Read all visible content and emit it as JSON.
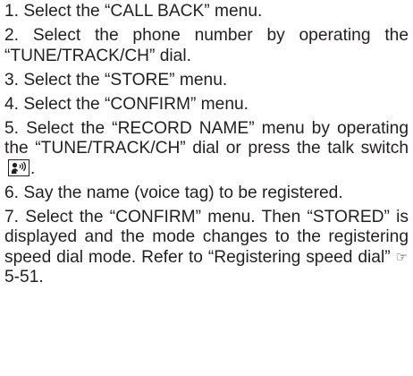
{
  "steps": [
    {
      "number": "1.",
      "text": "Select the “CALL BACK” menu."
    },
    {
      "number": "2.",
      "text": "Select the phone number by operating the “TUNE/TRACK/CH” dial."
    },
    {
      "number": "3.",
      "text": "Select the “STORE” menu."
    },
    {
      "number": "4.",
      "text": "Select the “CONFIRM” menu."
    },
    {
      "number": "5.",
      "text": "Select the “RECORD NAME” menu by operating the “TUNE/TRACK/CH” dial or press the talk switch",
      "text_after_icon": ".",
      "icon": "talk-switch-icon"
    },
    {
      "number": "6.",
      "text": "Say the name (voice tag) to be registered."
    },
    {
      "number": "7.",
      "text": "Select the “CONFIRM” menu. Then “STORED” is displayed and the mode changes to the registering speed dial mode. Refer to “Registering speed dial”",
      "reference_icon": "page-reference-icon",
      "reference_page": "5-51",
      "text_after_reference": "."
    }
  ]
}
